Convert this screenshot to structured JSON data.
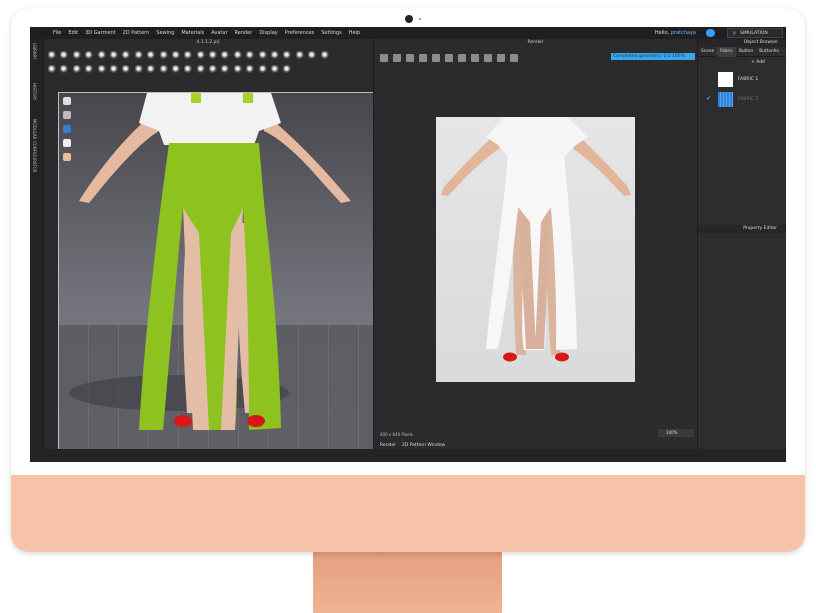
{
  "app": {
    "menu": [
      "File",
      "Edit",
      "3D Garment",
      "2D Pattern",
      "Sewing",
      "Materials",
      "Avatar",
      "Render",
      "Display",
      "Preferences",
      "Settings",
      "Help"
    ],
    "greeting": "Hello,",
    "user": "pratchaya",
    "simulation_label": "SIMULATION"
  },
  "left_tabs": [
    "LIBRARY",
    "HISTORY",
    "MODULAR CONFIGURATOR"
  ],
  "viewport": {
    "file_title": "4.1.1.2.prj",
    "version": "Version: 4.2.94 (r32777)"
  },
  "render": {
    "title": "Render",
    "progress_text": "Completed geometry: 1/1 100%",
    "progress": 1.0,
    "size_text": "400 x 640 Pixels",
    "zoom": "100%",
    "tabs": [
      "Render",
      "2D Pattern Window"
    ]
  },
  "object_browser": {
    "title": "Object Browser",
    "tabs": [
      "Scene",
      "Fabric",
      "Button",
      "Buttonho"
    ],
    "active_tab": "Fabric",
    "add_label": "+ Add",
    "fabrics": [
      {
        "name": "FABRIC 1",
        "swatch": "#ffffff"
      },
      {
        "name": "FABRIC 2",
        "swatch": "#2f82d8"
      }
    ]
  },
  "property_editor": {
    "title": "Property Editor"
  },
  "colors": {
    "accent": "#39a7ea",
    "pants_3d": "#8dc21f",
    "shoes": "#d81818",
    "bezel_body": "#f6c3a9"
  }
}
